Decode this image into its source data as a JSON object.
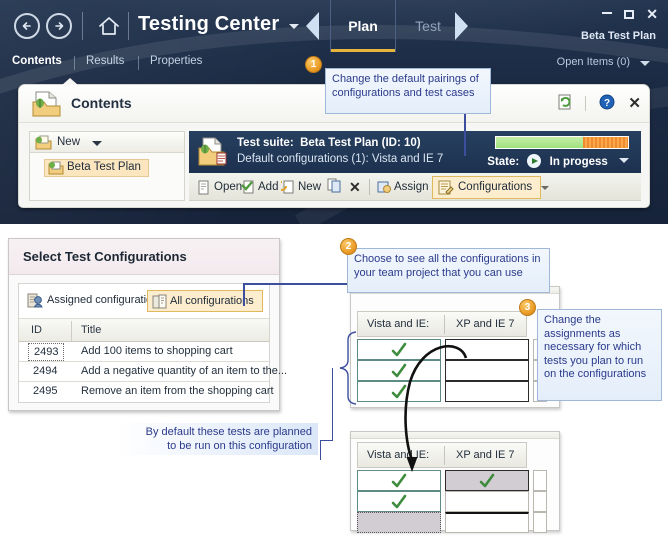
{
  "app": {
    "title": "Testing Center",
    "plan_label": "Beta Test Plan",
    "stages": [
      {
        "label": "Plan",
        "active": true
      },
      {
        "label": "Test",
        "active": false
      }
    ],
    "nav_tabs": [
      {
        "label": "Contents",
        "active": true
      },
      {
        "label": "Results",
        "active": false
      },
      {
        "label": "Properties",
        "active": false
      }
    ],
    "open_items": "Open Items (0)",
    "window_buttons": {
      "minimize": "minimize-icon",
      "maximize": "maximize-icon",
      "close": "close-icon"
    },
    "icons": {
      "back": "back-arrow-icon",
      "forward": "forward-arrow-icon",
      "home": "home-icon",
      "title_caret": "chevron-down-icon",
      "prev_stage": "left-triangle-icon",
      "next_stage": "right-triangle-icon"
    }
  },
  "panel": {
    "title": "Contents",
    "head_icon": "document-folder-icon",
    "tools": {
      "refresh": "refresh-page-icon",
      "help": "help-icon",
      "close": "close-icon"
    },
    "left_pane": {
      "new_label": "New",
      "new_icon": "new-suite-icon",
      "tree_items": [
        {
          "label": "Beta Test Plan",
          "icon": "test-plan-icon",
          "selected": true
        }
      ]
    },
    "suite": {
      "icon": "test-suite-icon",
      "line1_lead": "Test suite:",
      "line1_value": "Beta Test Plan (ID: 10)",
      "line2": "Default configurations (1): Vista and IE 7",
      "state_label": "State:",
      "state_value": "In progess",
      "state_icon": "play-icon",
      "state_caret": "chevron-down-icon",
      "progress": {
        "green_pct": 66,
        "orange_pct": 34
      }
    },
    "toolbar": {
      "items": [
        {
          "label": "Open",
          "icon": "open-icon"
        },
        {
          "label": "Add",
          "icon": "add-icon"
        },
        {
          "label": "New",
          "icon": "new-icon"
        },
        {
          "label": "",
          "icon": "copy-icon"
        },
        {
          "label": "",
          "icon": "delete-x-icon"
        },
        {
          "label": "Assign",
          "icon": "assign-icon"
        }
      ],
      "configurations_label": "Configurations",
      "configurations_icon": "configurations-icon",
      "overflow_icon": "chevron-down-icon"
    }
  },
  "dialog": {
    "title": "Select Test Configurations",
    "segments": [
      {
        "label": "Assigned configurations",
        "icon": "assigned-configurations-icon",
        "active": false
      },
      {
        "label": "All configurations",
        "icon": "all-configurations-icon",
        "active": true
      }
    ],
    "grid": {
      "columns": [
        "ID",
        "Title"
      ],
      "rows": [
        {
          "id": "2493",
          "title": "Add 100 items to shopping cart",
          "focused": true
        },
        {
          "id": "2494",
          "title": "Add a negative quantity of an item to the...",
          "focused": false
        },
        {
          "id": "2495",
          "title": "Remove an item from the shopping cart",
          "focused": false
        }
      ]
    }
  },
  "config_grids": [
    {
      "name": "before",
      "columns": [
        "Vista and IE:",
        "XP and IE 7"
      ],
      "rows": [
        {
          "vista": true,
          "xp": false,
          "vista_selected": false,
          "xp_selected": false
        },
        {
          "vista": true,
          "xp": false,
          "vista_selected": false,
          "xp_selected": false
        },
        {
          "vista": true,
          "xp": false,
          "vista_selected": false,
          "xp_selected": false
        }
      ]
    },
    {
      "name": "after",
      "columns": [
        "Vista and IE:",
        "XP and IE 7"
      ],
      "rows": [
        {
          "vista": true,
          "xp": true,
          "vista_selected": false,
          "xp_selected": true
        },
        {
          "vista": true,
          "xp": false,
          "vista_selected": false,
          "xp_selected": false
        },
        {
          "vista": false,
          "xp": false,
          "vista_selected": true,
          "xp_selected": false
        }
      ]
    }
  ],
  "callouts": [
    {
      "number": "1",
      "text": "Change the default pairings of configurations and test cases"
    },
    {
      "number": "2",
      "text": "Choose to see all the configurations in your team project that you can use"
    },
    {
      "number": "3",
      "text": "Change the assignments as necessary for which tests you plan to run on the configurations"
    }
  ],
  "caption": {
    "line1": "By default these tests are planned",
    "line2": "to be run on this configuration"
  },
  "colors": {
    "accent_gold": "#e7b53c",
    "chrome_dark": "#1b2a43",
    "highlight": "#fcedcf",
    "callout_text": "#2b3a8c",
    "check_green": "#3d8b3d",
    "progress_green": "#9fe07e",
    "progress_orange": "#f08c2e"
  }
}
